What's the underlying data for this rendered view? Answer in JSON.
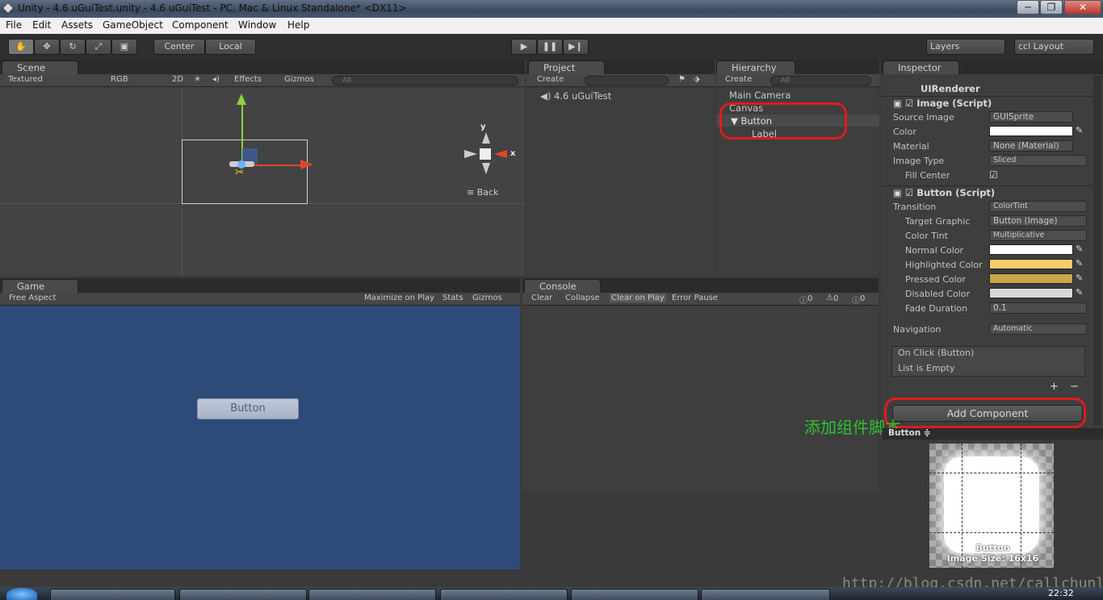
{
  "window": {
    "title": "Unity - 4.6 uGuiTest.unity - 4.6 uGuiTest - PC, Mac & Linux Standalone* <DX11>",
    "controls": [
      "─",
      "❐",
      "✕"
    ]
  },
  "menu": [
    "File",
    "Edit",
    "Assets",
    "GameObject",
    "Component",
    "Window",
    "Help"
  ],
  "toolbar": {
    "pivot": "Center",
    "space": "Local",
    "layers": "Layers",
    "layout": "ccl Layout"
  },
  "scene": {
    "tab": "Scene",
    "shading": "Textured",
    "render_mode": "RGB",
    "mode_2d": "2D",
    "effects": "Effects",
    "gizmos": "Gizmos",
    "search_placeholder": "All",
    "gizmo_y": "y",
    "gizmo_x": "x",
    "view": "Back"
  },
  "project": {
    "tab": "Project",
    "create": "Create",
    "item": "4.6 uGuiTest"
  },
  "hierarchy": {
    "tab": "Hierarchy",
    "create": "Create",
    "search_placeholder": "All",
    "items": [
      "Main Camera",
      "Canvas",
      "Button",
      "Label"
    ]
  },
  "game": {
    "tab": "Game",
    "aspect": "Free Aspect",
    "maximize": "Maximize on Play",
    "stats": "Stats",
    "gizmos": "Gizmos",
    "button_label": "Button",
    "bg_color": "#2d4a78"
  },
  "console": {
    "tab": "Console",
    "clear": "Clear",
    "collapse": "Collapse",
    "clear_on_play": "Clear on Play",
    "error_pause": "Error Pause",
    "count_log": "0",
    "count_warn": "0",
    "count_err": "0"
  },
  "inspector": {
    "tab": "Inspector",
    "ui_renderer": "UIRenderer",
    "image": {
      "header": "Image (Script)",
      "source_image_label": "Source Image",
      "source_image": "GUISprite",
      "color_label": "Color",
      "material_label": "Material",
      "material": "None (Material)",
      "image_type_label": "Image Type",
      "image_type": "Sliced",
      "fill_center_label": "Fill Center"
    },
    "button": {
      "header": "Button (Script)",
      "transition_label": "Transition",
      "transition": "ColorTint",
      "target_graphic_label": "Target Graphic",
      "target_graphic": "Button (Image)",
      "color_tint_label": "Color Tint",
      "color_tint": "Multiplicative",
      "normal_label": "Normal Color",
      "highlighted_label": "Highlighted Color",
      "pressed_label": "Pressed Color",
      "disabled_label": "Disabled Color",
      "fade_label": "Fade Duration",
      "fade": "0.1",
      "navigation_label": "Navigation",
      "navigation": "Automatic",
      "onclick": "On Click (Button)",
      "list_empty": "List is Empty"
    },
    "add_component": "Add Component",
    "annotation": "添加组件脚本",
    "preview_title": "Button ≑",
    "preview_name": "Button",
    "preview_size": "Image Size: 16x16",
    "colors": {
      "color": "#ffffff",
      "normal": "#ffffff",
      "highlighted": "#f5cc6a",
      "pressed": "#c8a64a",
      "disabled": "#d8d8d8"
    }
  },
  "watermark": "http://blog.csdn.net/callchunli",
  "taskbar": {
    "time": "22:32"
  }
}
